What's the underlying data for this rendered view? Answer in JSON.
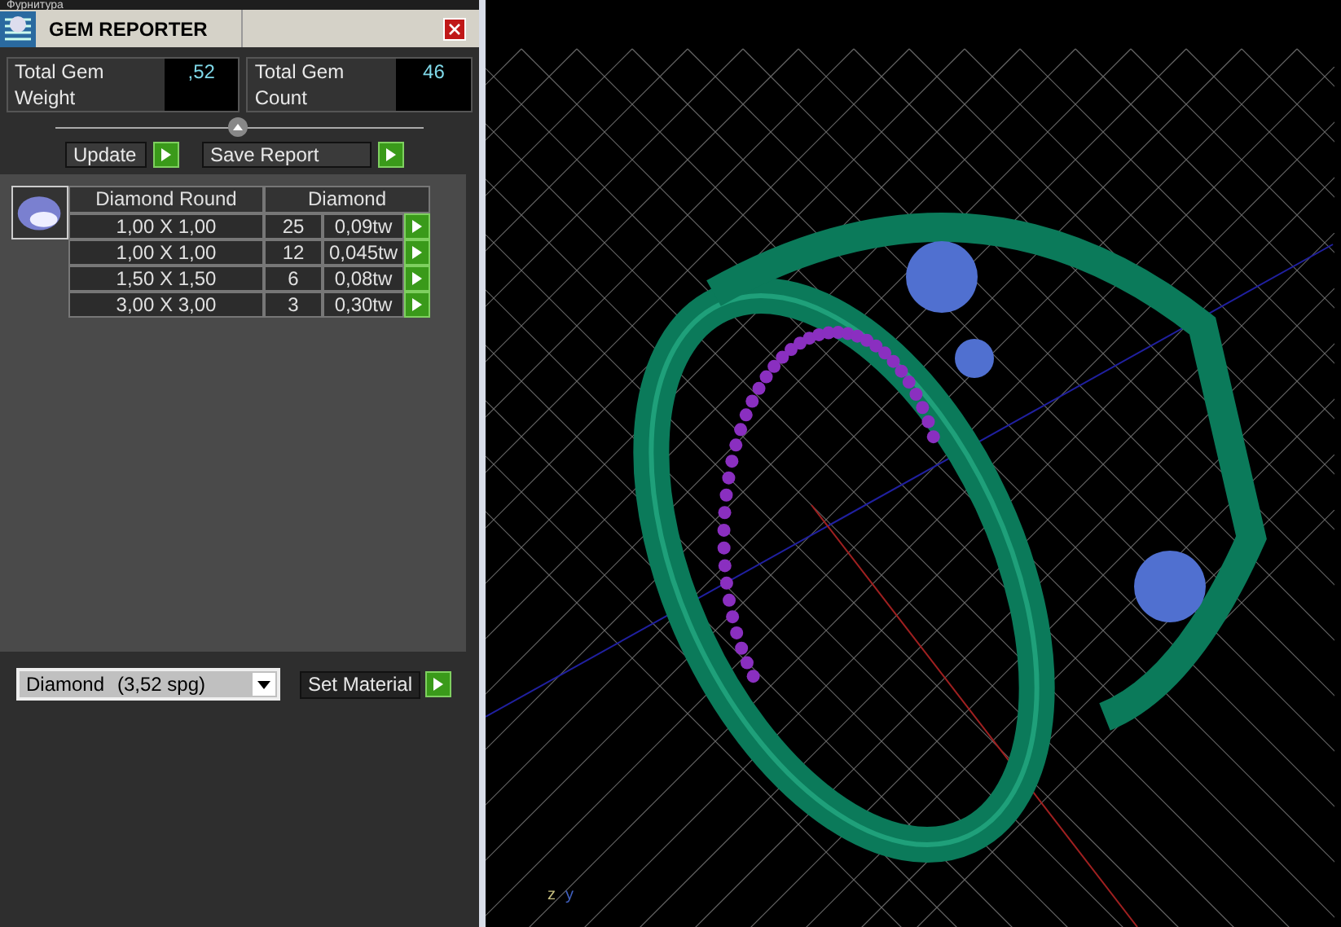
{
  "top_tab": {
    "label": "Фурнитура"
  },
  "window": {
    "title": "GEM REPORTER"
  },
  "totals": [
    {
      "label": "Total Gem Weight",
      "value": ",52"
    },
    {
      "label": "Total Gem Count",
      "value": "46"
    }
  ],
  "buttons": [
    {
      "label": "Update"
    },
    {
      "label": "Save Report"
    }
  ],
  "table": {
    "columns": [
      "Diamond Round",
      "Diamond"
    ],
    "rows": [
      {
        "size": "1,00 X 1,00",
        "count": "25",
        "weight": "0,09tw"
      },
      {
        "size": "1,00 X 1,00",
        "count": "12",
        "weight": "0,045tw"
      },
      {
        "size": "1,50 X 1,50",
        "count": "6",
        "weight": "0,08tw"
      },
      {
        "size": "3,00 X 3,00",
        "count": "3",
        "weight": "0,30tw"
      }
    ]
  },
  "material": {
    "name": "Diamond",
    "density": "(3,52 spg)",
    "button": "Set Material"
  },
  "viewport": {
    "axes": [
      "z",
      "y"
    ]
  }
}
